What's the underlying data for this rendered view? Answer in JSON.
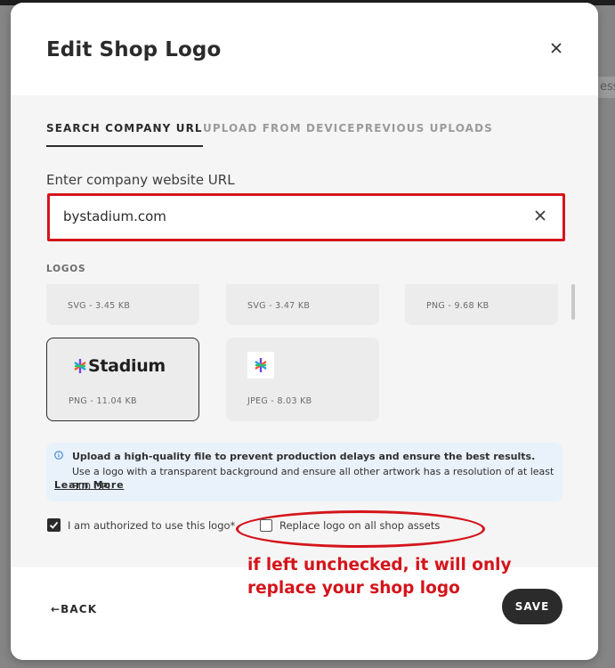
{
  "background": {
    "peek_text": "ess"
  },
  "modal": {
    "title": "Edit Shop Logo",
    "tabs": [
      {
        "label": "SEARCH COMPANY URL",
        "active": true
      },
      {
        "label": "UPLOAD FROM DEVICE",
        "active": false
      },
      {
        "label": "PREVIOUS UPLOADS",
        "active": false
      }
    ],
    "url": {
      "label": "Enter company website URL",
      "value": "bystadium.com"
    },
    "logos": {
      "label": "LOGOS",
      "items": [
        {
          "meta": "SVG - 3.45 KB"
        },
        {
          "meta": "SVG - 3.47 KB"
        },
        {
          "meta": "PNG - 9.68 KB"
        },
        {
          "meta": "PNG - 11.04 KB",
          "brand_text": "Stadium",
          "selected": true
        },
        {
          "meta": "JPEG - 8.03 KB"
        }
      ]
    },
    "info": {
      "bold_text": "Upload a high-quality file to prevent production delays and ensure the best results.",
      "text": " Use a logo with a transparent background and ensure all other artwork has a resolution of at least 300 DPI.",
      "link": "Learn More"
    },
    "authorized": {
      "label": "I am authorized to use this logo*",
      "checked": true
    },
    "replace": {
      "label": "Replace logo on all shop assets",
      "checked": false
    },
    "footer": {
      "back_label": "BACK",
      "save_label": "SAVE"
    }
  },
  "annotation": {
    "line1": "if left unchecked, it will only",
    "line2": "replace your shop logo"
  },
  "colors": {
    "accent_red": "#d5141b",
    "dark": "#2b2b2b",
    "info_bg": "#e9f1fb",
    "body_bg": "#f5f5f5"
  }
}
